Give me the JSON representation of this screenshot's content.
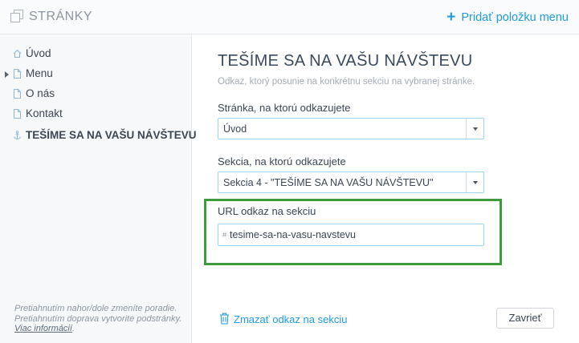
{
  "header": {
    "title": "STRÁNKY",
    "add_label": "Pridať položku menu",
    "add_icon": "plus-icon",
    "pages_icon": "pages-icon"
  },
  "sidebar": {
    "items": [
      {
        "label": "Úvod",
        "icon": "home-icon"
      },
      {
        "label": "Menu",
        "icon": "page-icon",
        "expandable": true
      },
      {
        "label": "O nás",
        "icon": "page-icon"
      },
      {
        "label": "Kontakt",
        "icon": "page-icon"
      },
      {
        "label": "TEŠÍME SA NA VAŠU NÁVŠTEVU",
        "icon": "anchor-icon",
        "active": true
      }
    ],
    "hint_text": "Pretiahnutím nahor/dole zmeníte poradie. Pretiahnutím doprava vytvorite podstránky.",
    "hint_link": "Viac informácií",
    "hint_end": "."
  },
  "form": {
    "title": "TEŠÍME SA NA VAŠU NÁVŠTEVU",
    "subtitle": "Odkaz, ktorý posunie na konkrétnu sekciu na vybranej stránke.",
    "page_label": "Stránka, na ktorú odkazujete",
    "page_value": "Úvod",
    "section_label": "Sekcia, na ktorú odkazujete",
    "section_value": "Sekcia 4 - \"TEŠÍME SA NA VAŠU NÁVŠTEVU\"",
    "url_label": "URL odkaz na sekciu",
    "url_prefix": "#",
    "url_value": "tesime-sa-na-vasu-navstevu",
    "delete_label": "Zmazať odkaz na sekciu",
    "close_label": "Zavrieť"
  },
  "colors": {
    "accent": "#1e9be0",
    "highlight_border": "#3d9a3d",
    "input_border": "#9cd2f2"
  }
}
